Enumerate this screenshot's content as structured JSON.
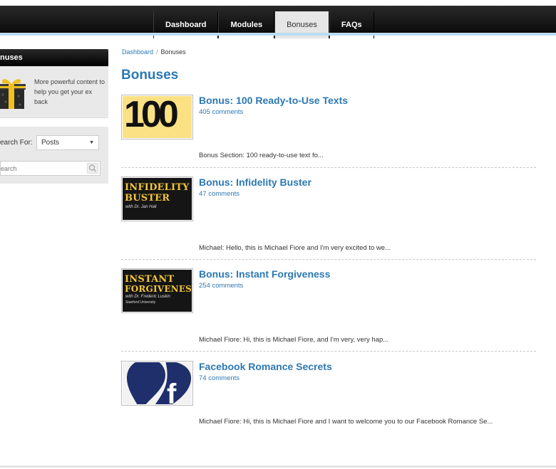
{
  "nav": {
    "items": [
      {
        "label": "Dashboard",
        "active": false
      },
      {
        "label": "Modules",
        "active": false
      },
      {
        "label": "Bonuses",
        "active": true
      },
      {
        "label": "FAQs",
        "active": false
      }
    ]
  },
  "sidebar": {
    "title": "nuses",
    "promo_text": "More powerful content to help you get your ex back",
    "search_label": "earch For:",
    "select_value": "Posts",
    "search_placeholder": "earch"
  },
  "breadcrumb": {
    "home": "Dashboard",
    "separator": "/",
    "current": "Bonuses"
  },
  "page_title": "Bonuses",
  "posts": [
    {
      "title": "Bonus: 100 Ready-to-Use Texts",
      "comments": "405 comments",
      "excerpt": "Bonus Section: 100 ready-to-use text fo...",
      "thumb_text": "100"
    },
    {
      "title": "Bonus: Infidelity Buster",
      "comments": "47 comments",
      "excerpt": "Michael: Hello, this is Michael Fiore and I'm very excited to we...",
      "thumb_line1": "INFIDELITY",
      "thumb_line2": "BUSTER",
      "thumb_sub": "with Dr. Jan Hall"
    },
    {
      "title": "Bonus: Instant Forgiveness",
      "comments": "254 comments",
      "excerpt": "Michael Fiore: Hi, this is Michael Fiore, and I'm very, very hap...",
      "thumb_line1": "INSTANT",
      "thumb_line2": "FORGIVENESS",
      "thumb_sub": "with Dr. Frederic Luskin",
      "thumb_sub2": "Stanford University"
    },
    {
      "title": "Facebook Romance Secrets",
      "comments": "74 comments",
      "excerpt": "Michael Fiore: Hi, this is Michael Fiore and I want to welcome you to our Facebook Romance Se...",
      "thumb_letter": "f"
    }
  ],
  "colors": {
    "link_blue": "#2c78b3",
    "gold": "#f3c53a",
    "facebook_navy": "#1e2f6b"
  }
}
